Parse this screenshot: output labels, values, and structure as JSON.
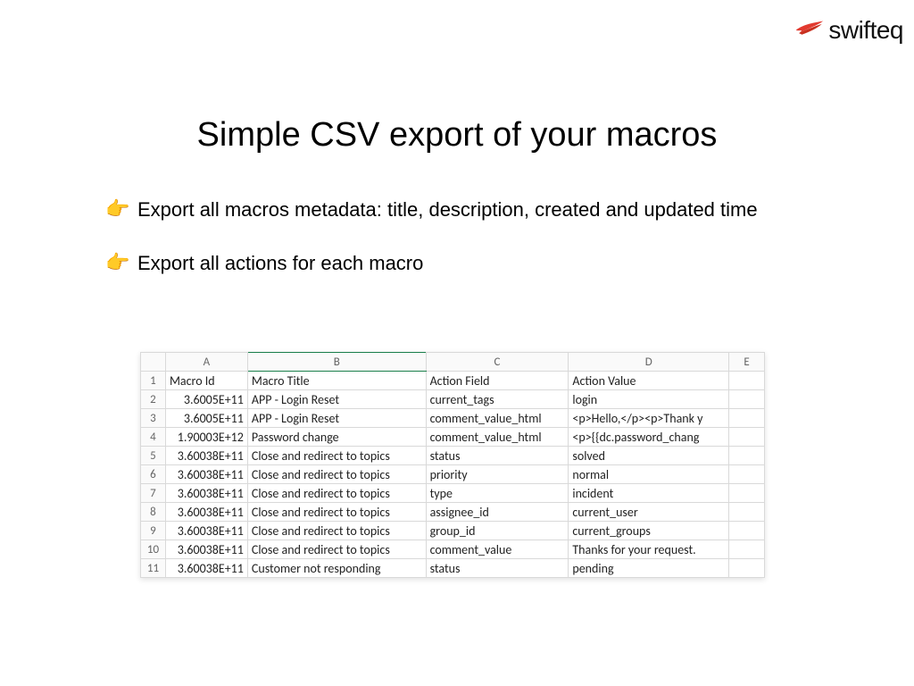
{
  "brand": {
    "name": "swifteq"
  },
  "title": "Simple CSV export of your macros",
  "bullets": [
    "Export all macros metadata: title, description, created and updated time",
    "Export all actions for each macro"
  ],
  "sheet": {
    "columns": [
      "A",
      "B",
      "C",
      "D",
      "E"
    ],
    "header": {
      "A": "Macro Id",
      "B": "Macro Title",
      "C": "Action Field",
      "D": "Action Value",
      "E": ""
    },
    "rows": [
      {
        "n": 2,
        "A": "3.6005E+11",
        "B": "APP - Login Reset",
        "C": "current_tags",
        "D": "login",
        "E": ""
      },
      {
        "n": 3,
        "A": "3.6005E+11",
        "B": "APP - Login Reset",
        "C": "comment_value_html",
        "D": "<p>Hello,</p><p>Thank y",
        "E": ""
      },
      {
        "n": 4,
        "A": "1.90003E+12",
        "B": "Password change",
        "C": "comment_value_html",
        "D": "<p>{{dc.password_chang",
        "E": ""
      },
      {
        "n": 5,
        "A": "3.60038E+11",
        "B": "Close and redirect to topics",
        "C": "status",
        "D": "solved",
        "E": ""
      },
      {
        "n": 6,
        "A": "3.60038E+11",
        "B": "Close and redirect to topics",
        "C": "priority",
        "D": "normal",
        "E": ""
      },
      {
        "n": 7,
        "A": "3.60038E+11",
        "B": "Close and redirect to topics",
        "C": "type",
        "D": "incident",
        "E": ""
      },
      {
        "n": 8,
        "A": "3.60038E+11",
        "B": "Close and redirect to topics",
        "C": "assignee_id",
        "D": "current_user",
        "E": ""
      },
      {
        "n": 9,
        "A": "3.60038E+11",
        "B": "Close and redirect to topics",
        "C": "group_id",
        "D": "current_groups",
        "E": ""
      },
      {
        "n": 10,
        "A": "3.60038E+11",
        "B": "Close and redirect to topics",
        "C": "comment_value",
        "D": "Thanks for your request. ",
        "E": ""
      },
      {
        "n": 11,
        "A": "3.60038E+11",
        "B": "Customer not responding",
        "C": "status",
        "D": "pending",
        "E": ""
      }
    ]
  }
}
